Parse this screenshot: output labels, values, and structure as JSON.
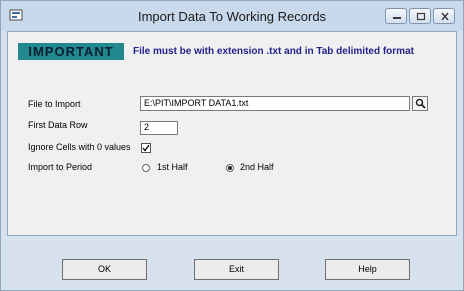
{
  "window": {
    "title": "Import Data To Working Records"
  },
  "notice": {
    "badge": "IMPORTANT",
    "message": "File must be with extension .txt and in Tab delimited format"
  },
  "form": {
    "file_label": "File to Import",
    "file_value": "E:\\PIT\\IMPORT DATA1.txt",
    "first_row_label": "First Data Row",
    "first_row_value": "2",
    "ignore_label": "Ignore Cells with 0 values",
    "ignore_checked": true,
    "period_label": "Import to Period",
    "period_options": [
      "1st Half",
      "2nd Half"
    ],
    "period_selected": "2nd Half"
  },
  "buttons": {
    "ok": "OK",
    "exit": "Exit",
    "help": "Help"
  }
}
